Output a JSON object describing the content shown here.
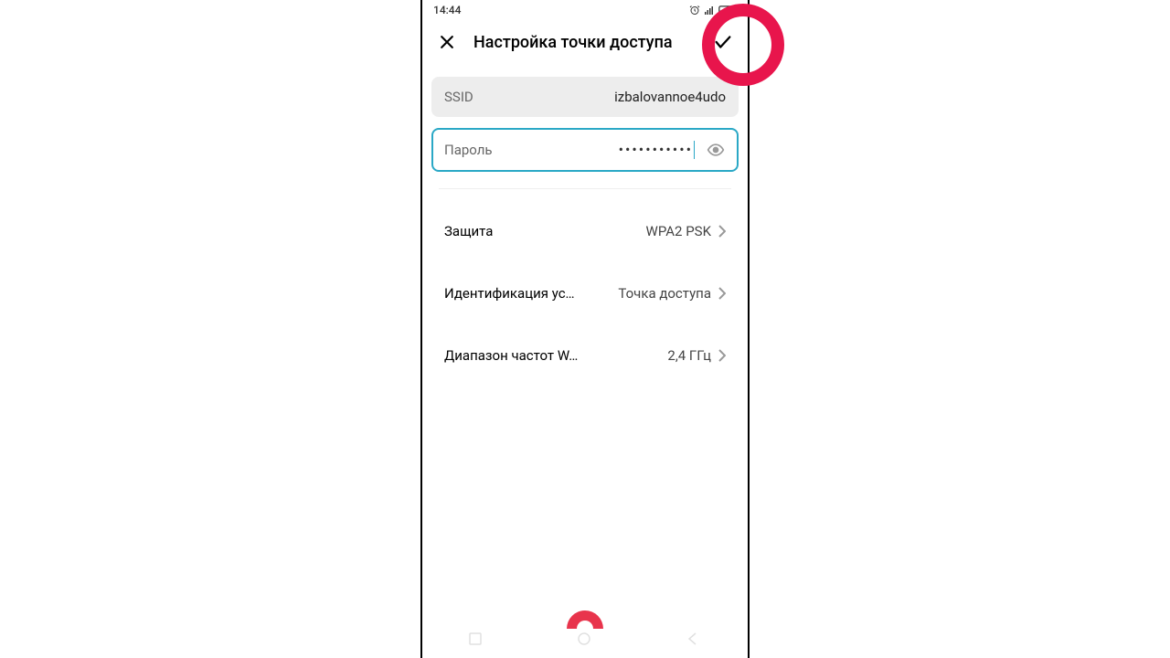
{
  "status": {
    "time": "14:44",
    "icons": "⏰ 📶 📡 🔋"
  },
  "header": {
    "title": "Настройка точки доступа"
  },
  "ssid": {
    "label": "SSID",
    "value": "izbalovannoe4udo"
  },
  "password": {
    "label": "Пароль",
    "masked": "•••••••••••"
  },
  "settings": {
    "security": {
      "label": "Защита",
      "value": "WPA2 PSK"
    },
    "deviceId": {
      "label": "Идентификация ус…",
      "value": "Точка доступа"
    },
    "band": {
      "label": "Диапазон частот W…",
      "value": "2,4 ГГц"
    }
  }
}
